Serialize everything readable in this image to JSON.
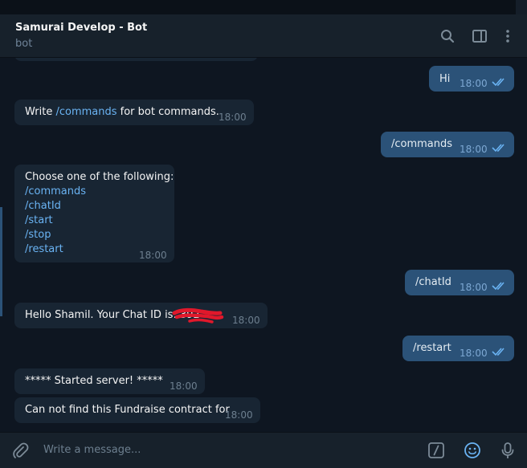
{
  "header": {
    "title": "Samurai Develop - Bot",
    "subtitle": "bot"
  },
  "messages": [
    {
      "text": "Hi",
      "time": "18:00"
    },
    {
      "prefix": "Write ",
      "link": "/commands",
      "suffix": " for bot commands.",
      "time": "18:00"
    },
    {
      "text": "/commands",
      "time": "18:00"
    },
    {
      "text": "Choose one of the following:",
      "links": [
        "/commands",
        "/chatId",
        "/start",
        "/stop",
        "/restart"
      ],
      "time": "18:00"
    },
    {
      "text": "/chatId",
      "time": "18:00"
    },
    {
      "text": "Hello Shamil. Your Chat ID is: 392",
      "time": "18:00"
    },
    {
      "text": "/restart",
      "time": "18:00"
    },
    {
      "text": "***** Started server! *****",
      "time": "18:00"
    },
    {
      "text": "Can not find this Fundraise contract for",
      "time": "18:00"
    }
  ],
  "composer": {
    "placeholder": "Write a message..."
  },
  "icons": {
    "search": "search-icon",
    "sidebar": "sidebar-toggle-icon",
    "more": "more-vertical-icon",
    "attach": "paperclip-icon",
    "commands": "slash-commands-icon",
    "emoji": "emoji-icon",
    "mic": "microphone-icon"
  },
  "colors": {
    "background": "#0e1621",
    "header": "#17212b",
    "incoming": "#182533",
    "outgoing": "#2b5278",
    "link": "#6ab3f3",
    "read_ticks": "#6ab3f3"
  }
}
